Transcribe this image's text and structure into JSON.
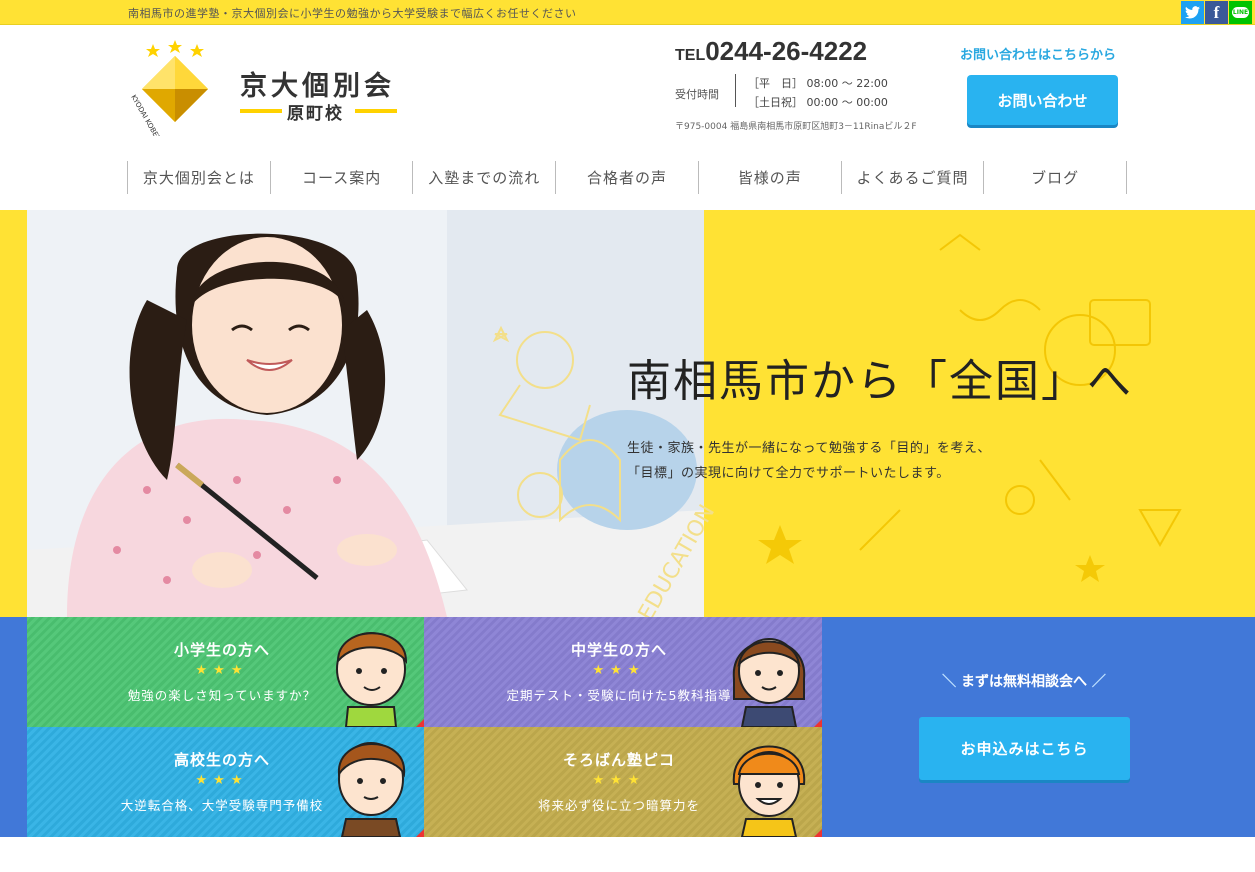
{
  "topbar": {
    "tagline": "南相馬市の進学塾・京大個別会に小学生の勉強から大学受験まで幅広くお任せください",
    "social": [
      "twitter-icon",
      "facebook-icon",
      "line-icon"
    ],
    "line_label": "LINE"
  },
  "logo": {
    "title": "京大個別会",
    "campus": "原町校",
    "arc_text": "KYODAI KOBETSUKAI"
  },
  "contact": {
    "tel_prefix": "TEL",
    "tel_number": "0244-26-4222",
    "hours_label": "受付時間",
    "hours": [
      {
        "day": "［平　日］",
        "time": "08:00 〜 22:00"
      },
      {
        "day": "［土日祝］",
        "time": "00:00 〜 00:00"
      }
    ],
    "address": "〒975-0004 福島県南相馬市原町区旭町3－11Rinaビル２F",
    "inquiry_text": "お問い合わせはこちらから",
    "inquiry_button": "お問い合わせ"
  },
  "nav": {
    "items": [
      "京大個別会とは",
      "コース案内",
      "入塾までの流れ",
      "合格者の声",
      "皆様の声",
      "よくあるご質問",
      "ブログ"
    ]
  },
  "hero": {
    "title": "南相馬市から「全国」へ",
    "subtitle_lines": [
      "生徒・家族・先生が一緒になって勉強する「目的」を考え、",
      "「目標」の実現に向けて全力でサポートいたします。"
    ]
  },
  "cards": [
    {
      "title": "小学生の方へ",
      "stars": "★★★",
      "desc": "勉強の楽しさ知っていますか？"
    },
    {
      "title": "中学生の方へ",
      "stars": "★★★",
      "desc": "定期テスト・受験に向けた5教科指導"
    },
    {
      "title": "高校生の方へ",
      "stars": "★★★",
      "desc": "大逆転合格、大学受験専門予備校"
    },
    {
      "title": "そろばん塾ピコ",
      "stars": "★★★",
      "desc": "将来必ず役に立つ暗算力を"
    }
  ],
  "consult": {
    "label": "まずは無料相談会へ",
    "button": "お申込みはこちら"
  },
  "colors": {
    "accent_yellow": "#ffe234",
    "button_blue": "#29b3f0",
    "section_blue": "#4178d8"
  }
}
